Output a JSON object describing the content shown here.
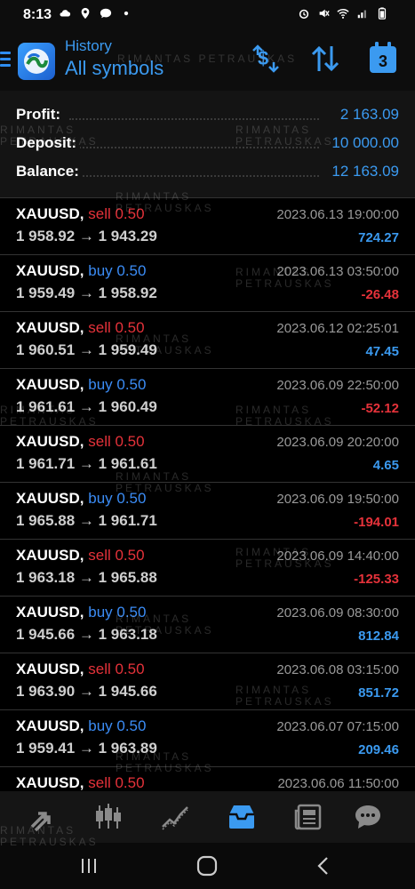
{
  "status_bar": {
    "time": "8:13"
  },
  "header": {
    "subtitle": "History",
    "title": "All symbols",
    "calendar_day": "3"
  },
  "summary": [
    {
      "label": "Profit:",
      "value": "2 163.09"
    },
    {
      "label": "Deposit:",
      "value": "10 000.00"
    },
    {
      "label": "Balance:",
      "value": "12 163.09"
    }
  ],
  "trades": [
    {
      "symbol": "XAUUSD,",
      "side": "sell 0.50",
      "type": "sell",
      "prices": "1 958.92 → 1 943.29",
      "time": "2023.06.13 19:00:00",
      "profit": "724.27"
    },
    {
      "symbol": "XAUUSD,",
      "side": "buy 0.50",
      "type": "buy",
      "prices": "1 959.49 → 1 958.92",
      "time": "2023.06.13 03:50:00",
      "profit": "-26.48"
    },
    {
      "symbol": "XAUUSD,",
      "side": "sell 0.50",
      "type": "sell",
      "prices": "1 960.51 → 1 959.49",
      "time": "2023.06.12 02:25:01",
      "profit": "47.45"
    },
    {
      "symbol": "XAUUSD,",
      "side": "buy 0.50",
      "type": "buy",
      "prices": "1 961.61 → 1 960.49",
      "time": "2023.06.09 22:50:00",
      "profit": "-52.12"
    },
    {
      "symbol": "XAUUSD,",
      "side": "sell 0.50",
      "type": "sell",
      "prices": "1 961.71 → 1 961.61",
      "time": "2023.06.09 20:20:00",
      "profit": "4.65"
    },
    {
      "symbol": "XAUUSD,",
      "side": "buy 0.50",
      "type": "buy",
      "prices": "1 965.88 → 1 961.71",
      "time": "2023.06.09 19:50:00",
      "profit": "-194.01"
    },
    {
      "symbol": "XAUUSD,",
      "side": "sell 0.50",
      "type": "sell",
      "prices": "1 963.18 → 1 965.88",
      "time": "2023.06.09 14:40:00",
      "profit": "-125.33"
    },
    {
      "symbol": "XAUUSD,",
      "side": "buy 0.50",
      "type": "buy",
      "prices": "1 945.66 → 1 963.18",
      "time": "2023.06.09 08:30:00",
      "profit": "812.84"
    },
    {
      "symbol": "XAUUSD,",
      "side": "sell 0.50",
      "type": "sell",
      "prices": "1 963.90 → 1 945.66",
      "time": "2023.06.08 03:15:00",
      "profit": "851.72"
    },
    {
      "symbol": "XAUUSD,",
      "side": "buy 0.50",
      "type": "buy",
      "prices": "1 959.41 → 1 963.89",
      "time": "2023.06.07 07:15:00",
      "profit": "209.46"
    },
    {
      "symbol": "XAUUSD,",
      "side": "sell 0.50",
      "type": "sell",
      "prices": "",
      "time": "2023.06.06 11:50:00",
      "profit": ""
    }
  ],
  "bottom_nav": [
    {
      "name": "trade-arrows-icon",
      "active": false
    },
    {
      "name": "candlestick-chart-icon",
      "active": false
    },
    {
      "name": "line-chart-icon",
      "active": false
    },
    {
      "name": "history-inbox-icon",
      "active": true
    },
    {
      "name": "news-icon",
      "active": false
    },
    {
      "name": "messages-icon",
      "active": false
    }
  ],
  "watermark": "RIMANTAS PETRAUSKAS",
  "colors": {
    "accent": "#3b9af0",
    "buy": "#3b8cf5",
    "sell": "#e5323a",
    "profit_positive": "#3b9af0",
    "profit_negative": "#e5323a"
  }
}
